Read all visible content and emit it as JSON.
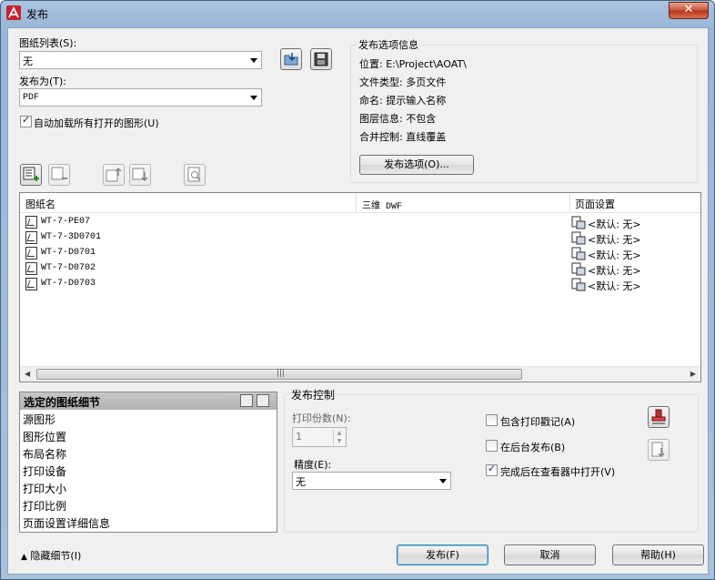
{
  "window": {
    "title": "发布",
    "close_label": "✕"
  },
  "sheet_list": {
    "label": "图纸列表(S):",
    "value": "无"
  },
  "publish_to": {
    "label": "发布为(T):",
    "value": "PDF"
  },
  "auto_load": {
    "label": "自动加载所有打开的图形(U)",
    "checked": true
  },
  "publish_info": {
    "title": "发布选项信息",
    "location": "位置: E:\\Project\\AOAT\\",
    "file_type": "文件类型: 多页文件",
    "naming": "命名: 提示输入名称",
    "layer_info": "图层信息: 不包含",
    "merge": "合并控制: 直线覆盖",
    "options_button": "发布选项(O)..."
  },
  "sheets_table": {
    "columns": [
      "图纸名",
      "三维 DWF",
      "页面设置"
    ],
    "rows": [
      {
        "name": "WT-7-PE07",
        "dwf3d": "",
        "page_setup": "<默认: 无>"
      },
      {
        "name": "WT-7-3D0701",
        "dwf3d": "",
        "page_setup": "<默认: 无>"
      },
      {
        "name": "WT-7-D0701",
        "dwf3d": "",
        "page_setup": "<默认: 无>"
      },
      {
        "name": "WT-7-D0702",
        "dwf3d": "",
        "page_setup": "<默认: 无>"
      },
      {
        "name": "WT-7-D0703",
        "dwf3d": "",
        "page_setup": "<默认: 无>"
      }
    ]
  },
  "selected_details": {
    "title": "选定的图纸细节",
    "items": [
      "源图形",
      "图形位置",
      "布局名称",
      "打印设备",
      "打印大小",
      "打印比例",
      "页面设置详细信息"
    ]
  },
  "publish_control": {
    "title": "发布控制",
    "copies_label": "打印份数(N):",
    "copies_value": "1",
    "precision_label": "精度(E):",
    "precision_value": "无",
    "include_stamp": {
      "label": "包含打印戳记(A)",
      "checked": false
    },
    "background": {
      "label": "在后台发布(B)",
      "checked": false
    },
    "open_viewer": {
      "label": "完成后在查看器中打开(V)",
      "checked": true
    }
  },
  "footer": {
    "hide_details": "隐藏细节(I)",
    "publish_button": "发布(F)",
    "cancel_button": "取消",
    "help_button": "帮助(H)"
  }
}
